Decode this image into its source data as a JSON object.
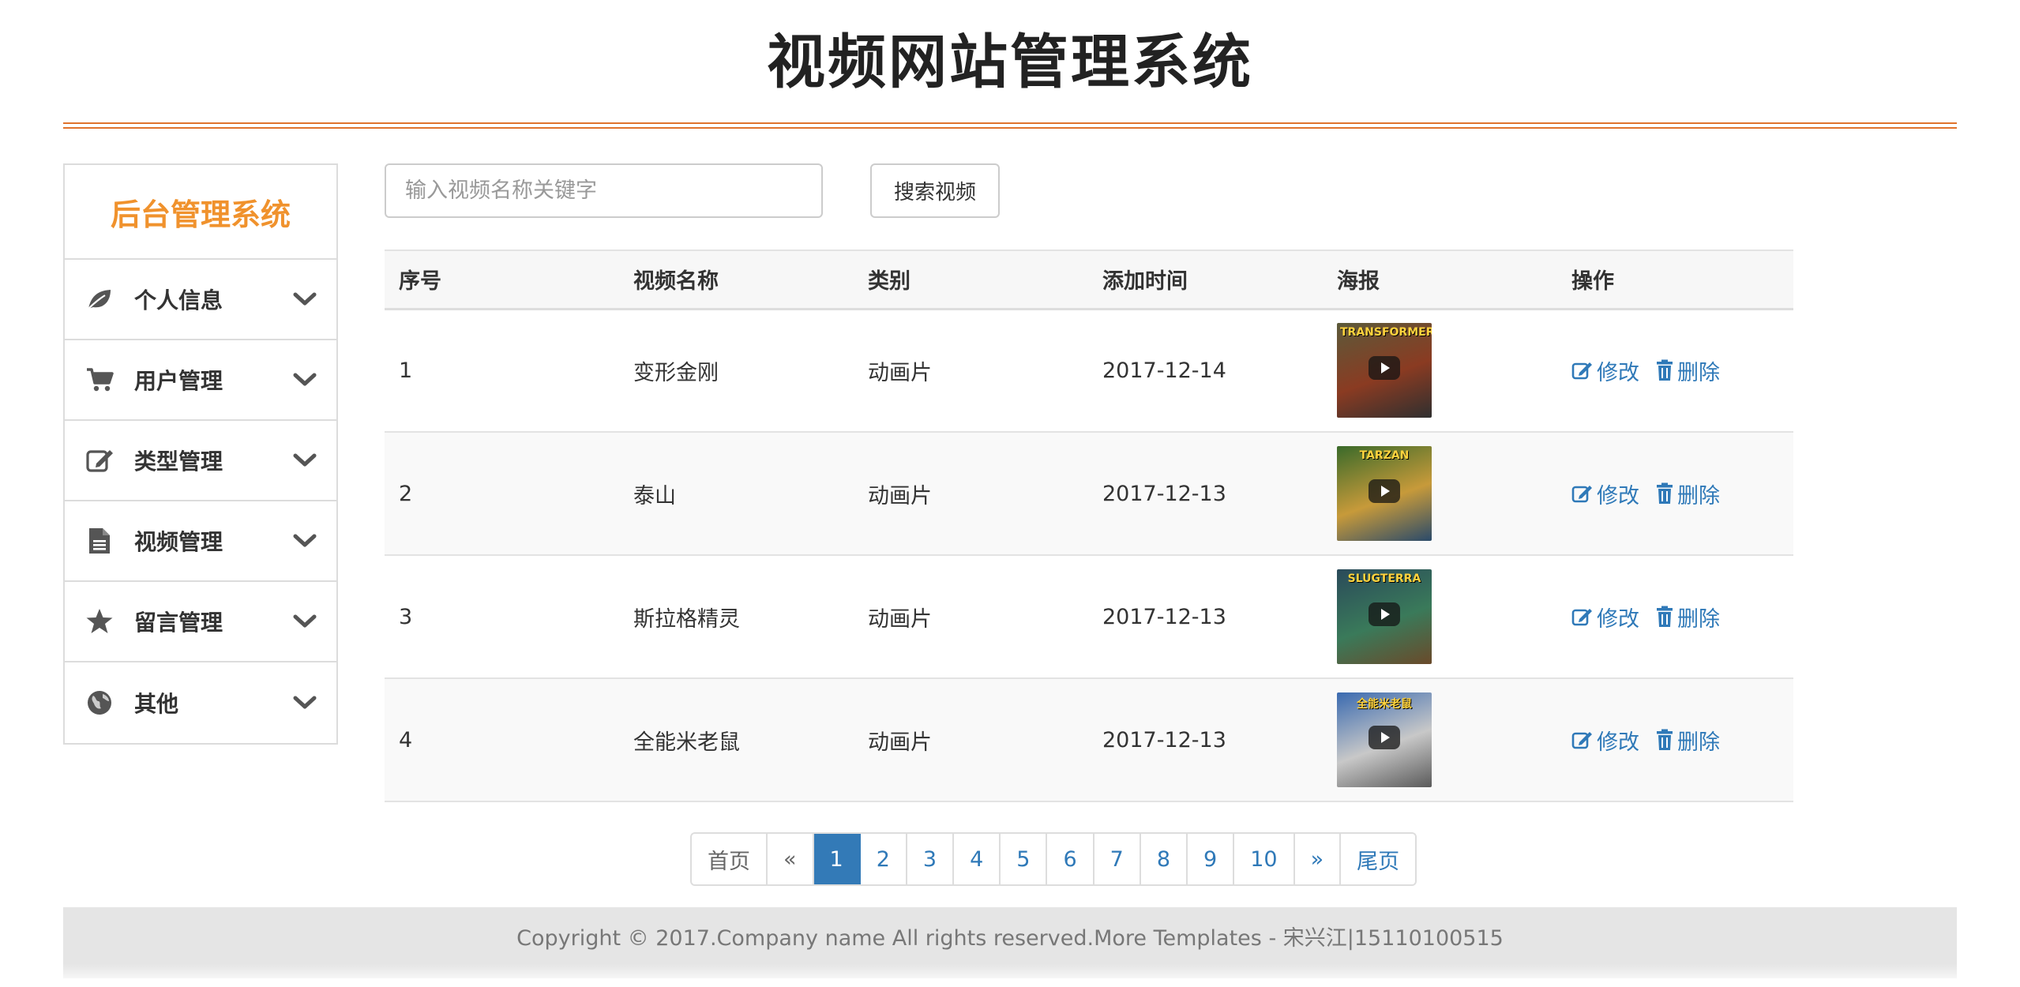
{
  "header": {
    "title": "视频网站管理系统"
  },
  "sidebar": {
    "title": "后台管理系统",
    "items": [
      {
        "label": "个人信息",
        "icon": "leaf-icon"
      },
      {
        "label": "用户管理",
        "icon": "cart-icon"
      },
      {
        "label": "类型管理",
        "icon": "edit-icon"
      },
      {
        "label": "视频管理",
        "icon": "file-icon"
      },
      {
        "label": "留言管理",
        "icon": "star-icon"
      },
      {
        "label": "其他",
        "icon": "globe-icon"
      }
    ]
  },
  "search": {
    "placeholder": "输入视频名称关键字",
    "value": "",
    "button_label": "搜索视频"
  },
  "table": {
    "headers": [
      "序号",
      "视频名称",
      "类别",
      "添加时间",
      "海报",
      "操作"
    ],
    "rows": [
      {
        "id": "1",
        "name": "变形金刚",
        "category": "动画片",
        "date": "2017-12-14",
        "poster": {
          "title": "TRANSFORMERS",
          "colors": [
            "#5b5a3a",
            "#8a3b22",
            "#2f2f2f"
          ]
        }
      },
      {
        "id": "2",
        "name": "泰山",
        "category": "动画片",
        "date": "2017-12-13",
        "poster": {
          "title": "TARZAN",
          "colors": [
            "#3a6a2a",
            "#c79a3a",
            "#2a4a6a"
          ]
        }
      },
      {
        "id": "3",
        "name": "斯拉格精灵",
        "category": "动画片",
        "date": "2017-12-13",
        "poster": {
          "title": "SLUGTERRA",
          "colors": [
            "#2a4a5a",
            "#3a7a5a",
            "#6a4a2a"
          ]
        }
      },
      {
        "id": "4",
        "name": "全能米老鼠",
        "category": "动画片",
        "date": "2017-12-13",
        "poster": {
          "title": "全能米老鼠",
          "colors": [
            "#3a6ab0",
            "#c8c8c8",
            "#5a5a5a"
          ]
        }
      }
    ],
    "edit_label": "修改",
    "delete_label": "删除"
  },
  "pagination": {
    "first": "首页",
    "prev": "«",
    "pages": [
      "1",
      "2",
      "3",
      "4",
      "5",
      "6",
      "7",
      "8",
      "9",
      "10"
    ],
    "active": "1",
    "next": "»",
    "last": "尾页"
  },
  "footer": {
    "text": "Copyright © 2017.Company name All rights reserved.More Templates - 宋兴江|15110100515"
  },
  "colors": {
    "accent": "#f0922d",
    "rule": "#e0732c",
    "link": "#2f79b8",
    "active_page": "#337ab7"
  }
}
